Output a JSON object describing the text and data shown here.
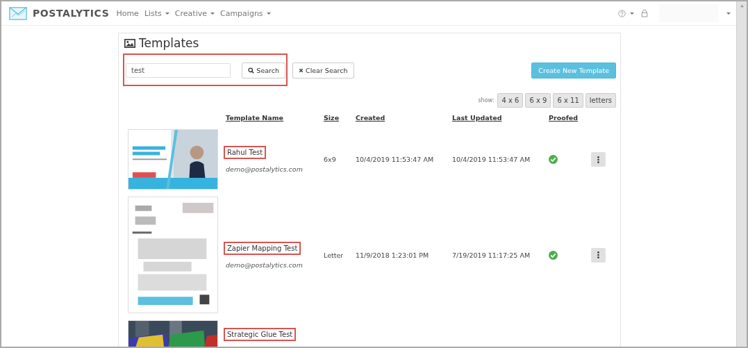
{
  "navbar": {
    "brand": "POSTALYTICS",
    "links": [
      {
        "label": "Home",
        "dropdown": false
      },
      {
        "label": "Lists",
        "dropdown": true
      },
      {
        "label": "Creative",
        "dropdown": true
      },
      {
        "label": "Campaigns",
        "dropdown": true
      }
    ]
  },
  "page": {
    "title": "Templates"
  },
  "search": {
    "value": "test",
    "highlighted": true,
    "search_button": "Search",
    "clear_button": "Clear Search"
  },
  "create_button": "Create New Template",
  "filters": {
    "label": "show:",
    "options": [
      "4 x 6",
      "6 x 9",
      "6 x 11",
      "letters"
    ]
  },
  "table": {
    "columns": [
      "Template Name",
      "Size",
      "Created",
      "Last Updated",
      "Proofed"
    ],
    "rows": [
      {
        "name": "Rahul Test",
        "highlighted": true,
        "owner": "demo@postalytics.com",
        "size": "6x9",
        "created": "10/4/2019 11:53:47 AM",
        "updated": "10/4/2019 11:53:47 AM",
        "proofed": true
      },
      {
        "name": "Zapier Mapping Test",
        "highlighted": true,
        "owner": "demo@postalytics.com",
        "size": "Letter",
        "created": "11/9/2018 1:23:01 PM",
        "updated": "7/19/2019 11:17:25 AM",
        "proofed": true
      },
      {
        "name": "Strategic Glue Test",
        "highlighted": true
      }
    ]
  }
}
